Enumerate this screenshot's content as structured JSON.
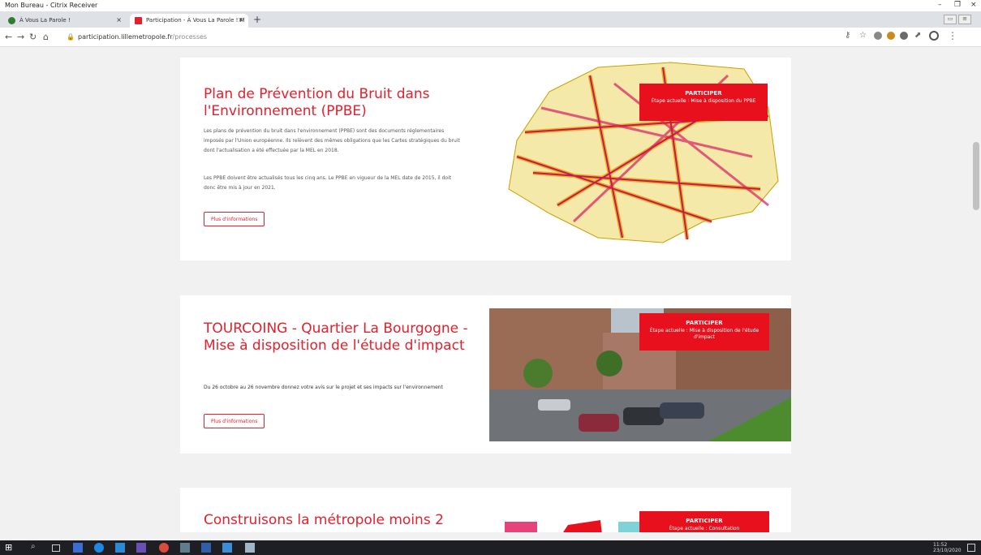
{
  "citrix": {
    "title": "Mon Bureau - Citrix Receiver",
    "minimize": "–",
    "restore": "❐",
    "close": "×"
  },
  "tabs": [
    {
      "label": "À Vous La Parole !",
      "close": "×"
    },
    {
      "label": "Participation - À Vous La Parole ! M",
      "close": "×"
    }
  ],
  "new_tab": "+",
  "address_bar": {
    "domain": "participation.lillemetropole.fr",
    "path": "/processes"
  },
  "cards": [
    {
      "title": "Plan de Prévention du Bruit dans l'Environnement (PPBE)",
      "para1": "Les plans de prévention du bruit dans l'environnement (PPBE) sont des documents réglementaires imposés par l'Union européenne. Ils relèvent des mêmes obligations que les Cartes stratégiques du bruit dont l'actualisation a été effectuée par la MEL en 2018.",
      "para2": "Les PPBE doivent être actualisés tous les cinq ans. Le PPBE en vigueur de la MEL date de 2015, il doit donc être mis à jour en 2021.",
      "more": "Plus d'informations",
      "cta_title": "PARTICIPER",
      "cta_sub": "Étape actuelle : Mise à disposition du PPBE"
    },
    {
      "title": "TOURCOING - Quartier La Bourgogne - Mise à disposition de l'étude d'impact",
      "para1": "Du 26 octobre au 26 novembre donnez votre avis sur le projet et ses impacts sur l'environnement",
      "more": "Plus d'informations",
      "cta_title": "PARTICIPER",
      "cta_sub": "Étape actuelle : Mise à disposition de l'étude d'impact"
    },
    {
      "title": "Construisons la métropole moins 2",
      "cta_title": "PARTICIPER",
      "cta_sub": "Étape actuelle : Consultation"
    }
  ],
  "taskbar": {
    "time": "11:52",
    "date": "23/10/2020"
  }
}
